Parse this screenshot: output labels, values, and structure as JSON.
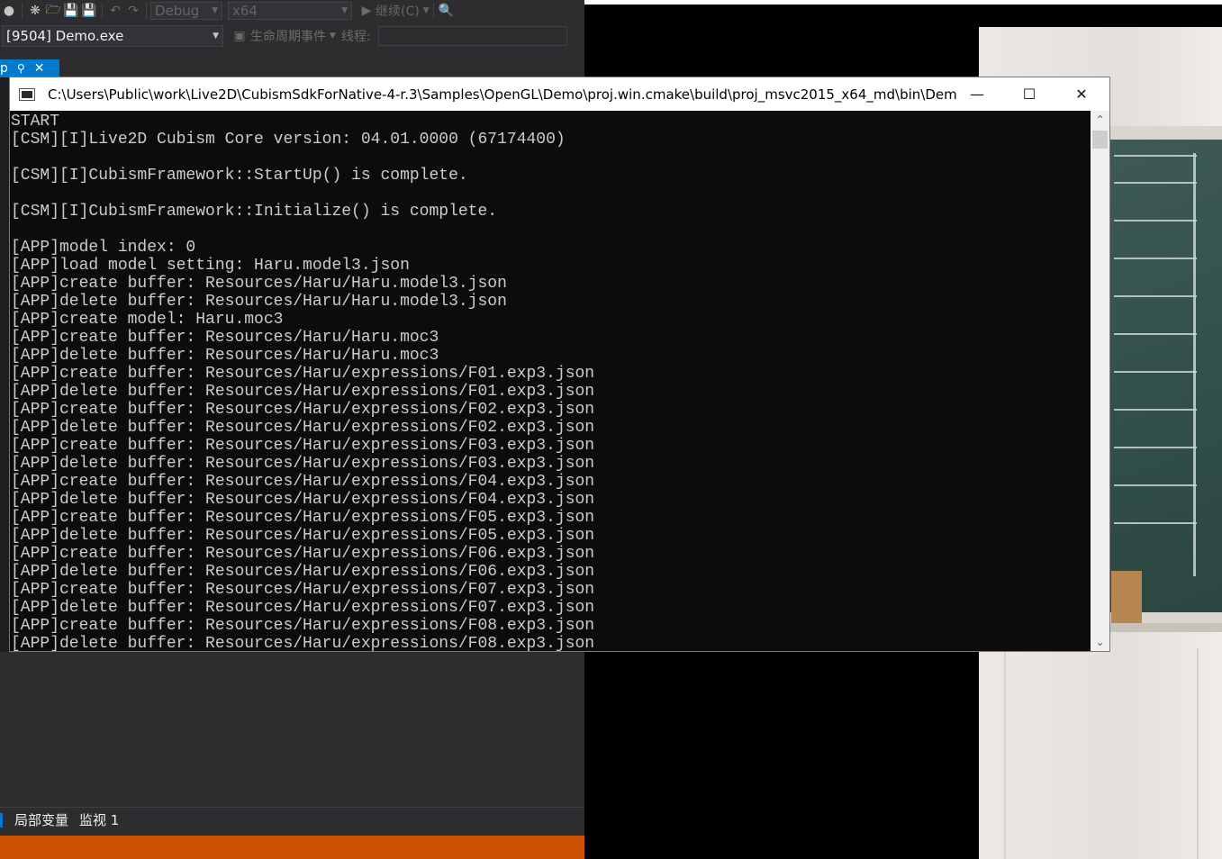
{
  "vs": {
    "toolbar": {
      "config": "Debug",
      "platform": "x64",
      "continue_label": "继续(C)"
    },
    "process": "[9504] Demo.exe",
    "lifecycle_label": "生命周期事件",
    "thread_label": "线程:",
    "tab_label": "p",
    "bottom_tabs": [
      "局部变量",
      "监视 1"
    ],
    "colors": {
      "accent": "#007acc",
      "status": "#ca5100"
    }
  },
  "console": {
    "title": "C:\\Users\\Public\\work\\Live2D\\CubismSdkForNative-4-r.3\\Samples\\OpenGL\\Demo\\proj.win.cmake\\build\\proj_msvc2015_x64_md\\bin\\Dem...",
    "lines": [
      "START",
      "[CSM][I]Live2D Cubism Core version: 04.01.0000 (67174400)",
      "",
      "[CSM][I]CubismFramework::StartUp() is complete.",
      "",
      "[CSM][I]CubismFramework::Initialize() is complete.",
      "",
      "[APP]model index: 0",
      "[APP]load model setting: Haru.model3.json",
      "[APP]create buffer: Resources/Haru/Haru.model3.json",
      "[APP]delete buffer: Resources/Haru/Haru.model3.json",
      "[APP]create model: Haru.moc3",
      "[APP]create buffer: Resources/Haru/Haru.moc3",
      "[APP]delete buffer: Resources/Haru/Haru.moc3",
      "[APP]create buffer: Resources/Haru/expressions/F01.exp3.json",
      "[APP]delete buffer: Resources/Haru/expressions/F01.exp3.json",
      "[APP]create buffer: Resources/Haru/expressions/F02.exp3.json",
      "[APP]delete buffer: Resources/Haru/expressions/F02.exp3.json",
      "[APP]create buffer: Resources/Haru/expressions/F03.exp3.json",
      "[APP]delete buffer: Resources/Haru/expressions/F03.exp3.json",
      "[APP]create buffer: Resources/Haru/expressions/F04.exp3.json",
      "[APP]delete buffer: Resources/Haru/expressions/F04.exp3.json",
      "[APP]create buffer: Resources/Haru/expressions/F05.exp3.json",
      "[APP]delete buffer: Resources/Haru/expressions/F05.exp3.json",
      "[APP]create buffer: Resources/Haru/expressions/F06.exp3.json",
      "[APP]delete buffer: Resources/Haru/expressions/F06.exp3.json",
      "[APP]create buffer: Resources/Haru/expressions/F07.exp3.json",
      "[APP]delete buffer: Resources/Haru/expressions/F07.exp3.json",
      "[APP]create buffer: Resources/Haru/expressions/F08.exp3.json",
      "[APP]delete buffer: Resources/Haru/expressions/F08.exp3.json"
    ]
  }
}
